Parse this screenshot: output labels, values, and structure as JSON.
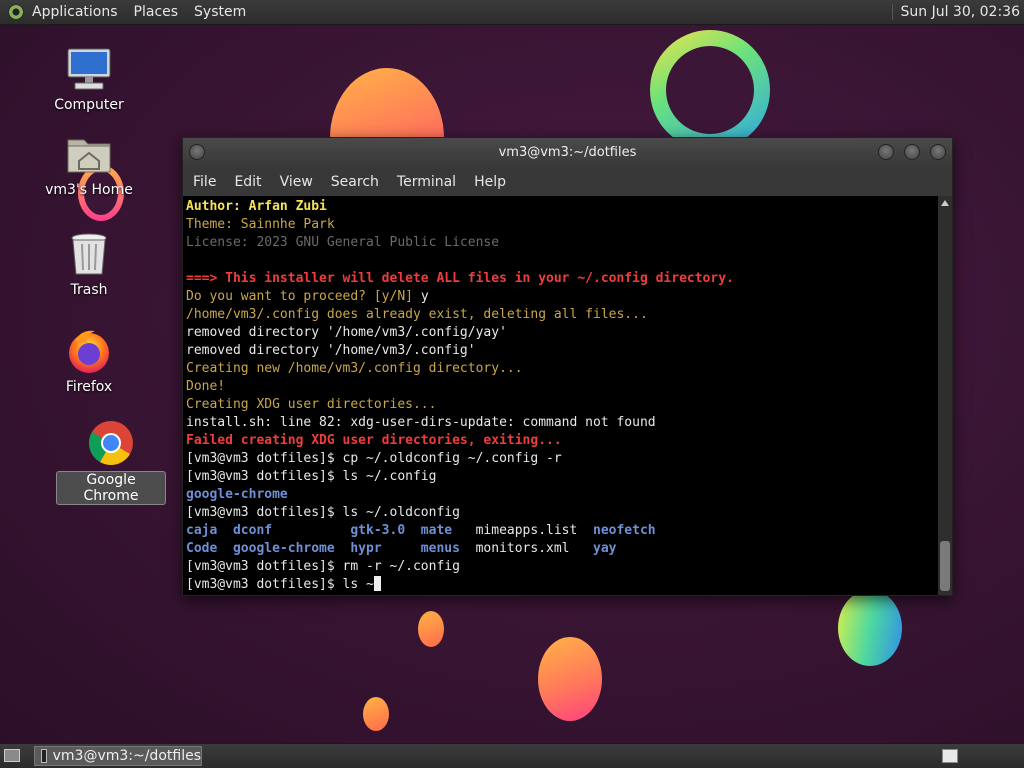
{
  "top_panel": {
    "menus": [
      "Applications",
      "Places",
      "System"
    ],
    "clock": "Sun Jul 30, 02:36"
  },
  "desktop": {
    "icons": [
      {
        "label": "Computer",
        "icon": "computer-icon"
      },
      {
        "label": "vm3's Home",
        "icon": "home-folder-icon"
      },
      {
        "label": "Trash",
        "icon": "trash-icon"
      },
      {
        "label": "Firefox",
        "icon": "firefox-icon"
      },
      {
        "label": "Google Chrome",
        "icon": "chrome-icon"
      }
    ]
  },
  "terminal": {
    "title": "vm3@vm3:~/dotfiles",
    "menus": [
      "File",
      "Edit",
      "View",
      "Search",
      "Terminal",
      "Help"
    ],
    "lines": [
      [
        {
          "t": "Author: Arfan Zubi",
          "c": "yellow-b"
        }
      ],
      [
        {
          "t": "Theme: Sainnhe Park",
          "c": "tan"
        }
      ],
      [
        {
          "t": "License: 2023 GNU General Public License",
          "c": "gray"
        }
      ],
      [
        {
          "t": "",
          "c": "white"
        }
      ],
      [
        {
          "t": "===> This installer will delete ALL files in your ~/.config directory.",
          "c": "red-b"
        }
      ],
      [
        {
          "t": "Do you want to proceed? [y/N] ",
          "c": "tan"
        },
        {
          "t": "y",
          "c": "white"
        }
      ],
      [
        {
          "t": "/home/vm3/.config does already exist, deleting all files...",
          "c": "tan"
        }
      ],
      [
        {
          "t": "removed directory '/home/vm3/.config/yay'",
          "c": "white"
        }
      ],
      [
        {
          "t": "removed directory '/home/vm3/.config'",
          "c": "white"
        }
      ],
      [
        {
          "t": "Creating new /home/vm3/.config directory...",
          "c": "tan"
        }
      ],
      [
        {
          "t": "Done!",
          "c": "tan"
        }
      ],
      [
        {
          "t": "Creating XDG user directories...",
          "c": "tan"
        }
      ],
      [
        {
          "t": "install.sh: line 82: xdg-user-dirs-update: command not found",
          "c": "white"
        }
      ],
      [
        {
          "t": "Failed creating XDG user directories, exiting...",
          "c": "red-b"
        }
      ],
      [
        {
          "t": "[vm3@vm3 dotfiles]$ cp ~/.oldconfig ~/.config -r",
          "c": "white"
        }
      ],
      [
        {
          "t": "[vm3@vm3 dotfiles]$ ls ~/.config",
          "c": "white"
        }
      ],
      [
        {
          "t": "google-chrome",
          "c": "blue-b"
        }
      ],
      [
        {
          "t": "[vm3@vm3 dotfiles]$ ls ~/.oldconfig",
          "c": "white"
        }
      ],
      [
        {
          "t": "caja  dconf          gtk-3.0  mate   ",
          "c": "blue-b"
        },
        {
          "t": "mimeapps.list  ",
          "c": "white"
        },
        {
          "t": "neofetch",
          "c": "blue-b"
        }
      ],
      [
        {
          "t": "Code  google-chrome  hypr     menus  ",
          "c": "blue-b"
        },
        {
          "t": "monitors.xml   ",
          "c": "white"
        },
        {
          "t": "yay",
          "c": "blue-b"
        }
      ],
      [
        {
          "t": "[vm3@vm3 dotfiles]$ rm -r ~/.config",
          "c": "white"
        }
      ],
      [
        {
          "t": "[vm3@vm3 dotfiles]$ ls ~",
          "c": "white"
        }
      ]
    ]
  },
  "taskbar": {
    "items": [
      {
        "label": "vm3@vm3:~/dotfiles"
      }
    ]
  }
}
